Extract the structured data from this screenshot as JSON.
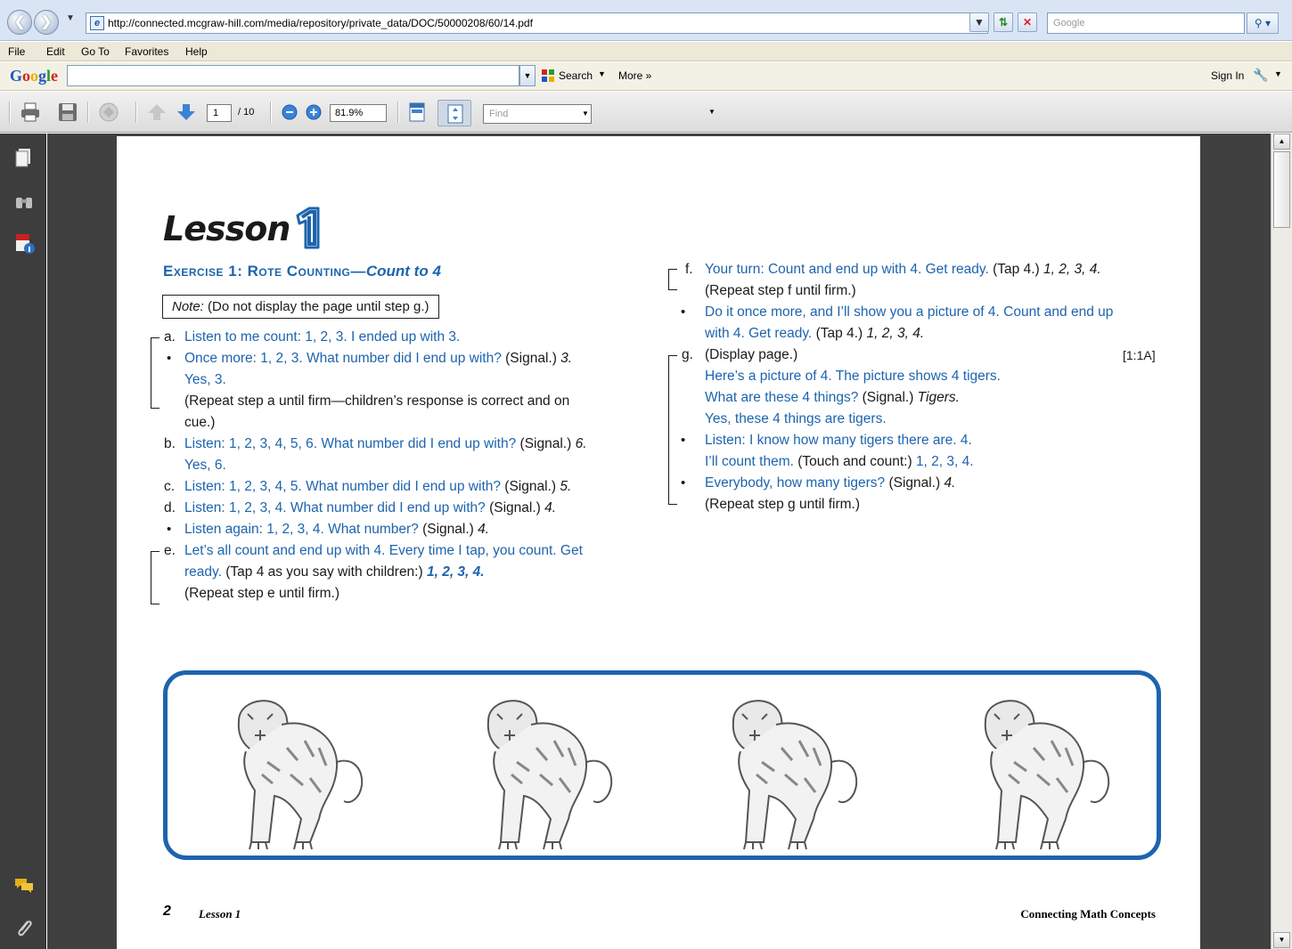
{
  "browser": {
    "url": "http://connected.mcgraw-hill.com/media/repository/private_data/DOC/50000208/60/14.pdf",
    "search_placeholder": "Google",
    "menu": [
      "File",
      "Edit",
      "Go To",
      "Favorites",
      "Help"
    ],
    "google_toolbar": {
      "logo": [
        "G",
        "o",
        "o",
        "g",
        "l",
        "e"
      ],
      "search_label": "Search",
      "more_label": "More »",
      "sign_in": "Sign In"
    }
  },
  "pdf_toolbar": {
    "page_current": "1",
    "page_total": "/ 10",
    "zoom": "81.9%",
    "find_placeholder": "Find"
  },
  "colors": {
    "accent_blue": "#1d64ae",
    "viewer_background": "#404040",
    "chrome_blue": "#d9e5f5"
  },
  "nav_panel_icons": [
    "pages-icon",
    "attachments-binoculars-icon",
    "pdf-info-icon",
    "comments-icon",
    "paperclip-icon"
  ],
  "page": {
    "lesson_title": "Lesson",
    "lesson_number": "1",
    "exercise": {
      "prefix": "Exercise 1: Rote Counting—",
      "suffix": "Count to 4"
    },
    "note": {
      "label": "Note:",
      "text": " (Do not display the page until step g.)"
    },
    "left_column": {
      "a": {
        "label": "a.",
        "blue": "Listen to me count: 1, 2, 3. I ended up with 3."
      },
      "a_bullet": {
        "blue": "Once more: 1, 2, 3. What number did I end up with?",
        "black": " (Signal.) ",
        "italic": "3.",
        "line2": "Yes, 3."
      },
      "a_repeat": {
        "line1": "(Repeat step a until firm—children’s response is correct and on",
        "line2": "cue.)"
      },
      "b": {
        "label": "b.",
        "blue": "Listen: 1, 2, 3, 4, 5, 6. What number did I end up with?",
        "black": " (Signal.) ",
        "italic": "6.",
        "line2": "Yes, 6."
      },
      "c": {
        "label": "c.",
        "blue": "Listen: 1, 2, 3, 4, 5. What number did I end up with?",
        "black": " (Signal.) ",
        "italic": "5."
      },
      "d": {
        "label": "d.",
        "blue": "Listen: 1, 2, 3, 4. What number did I end up with?",
        "black": " (Signal.) ",
        "italic": "4."
      },
      "d_bullet": {
        "blue": "Listen again: 1, 2, 3, 4. What number?",
        "black": " (Signal.) ",
        "italic": "4."
      },
      "e": {
        "label": "e.",
        "blue": "Let’s all count and end up with 4. Every time I tap, you count. Get",
        "blue2": "ready.",
        "black2": " (Tap 4 as you say with children:) ",
        "bold_italic": "1, 2, 3, 4."
      },
      "e_repeat": "(Repeat step e until firm.)"
    },
    "right_column": {
      "f": {
        "label": "f.",
        "blue": "Your turn: Count and end up with 4. Get ready.",
        "black": " (Tap 4.) ",
        "italic": "1, 2, 3, 4."
      },
      "f_repeat": "(Repeat step f until firm.)",
      "f_bullet": {
        "blue": "Do it once more, and I’ll show you a picture of 4. Count and end up",
        "blue2": "with 4. Get ready.",
        "black2": " (Tap 4.) ",
        "italic2": "1, 2, 3, 4."
      },
      "g": {
        "label": "g.",
        "black": "(Display page.)",
        "ref": "[1:1A]"
      },
      "g_lines": {
        "l1": "Here’s a picture of 4. The picture shows 4 tigers.",
        "l2_blue": "What are these 4 things?",
        "l2_black": " (Signal.) ",
        "l2_italic": "Tigers.",
        "l3": "Yes, these 4 things are tigers."
      },
      "g_bullet1": {
        "blue": "Listen: I know how many tigers there are. 4.",
        "blue2": "I’ll count them.",
        "black2": " (Touch and count:) ",
        "blue3": "1, 2, 3, 4."
      },
      "g_bullet2": {
        "blue": "Everybody, how many tigers?",
        "black": " (Signal.) ",
        "italic": "4."
      },
      "g_repeat": "(Repeat step g until firm.)"
    },
    "bullet_char": "•",
    "tiger_count": 4,
    "footer": {
      "page_number": "2",
      "lesson": "Lesson 1",
      "book": "Connecting Math Concepts"
    }
  }
}
